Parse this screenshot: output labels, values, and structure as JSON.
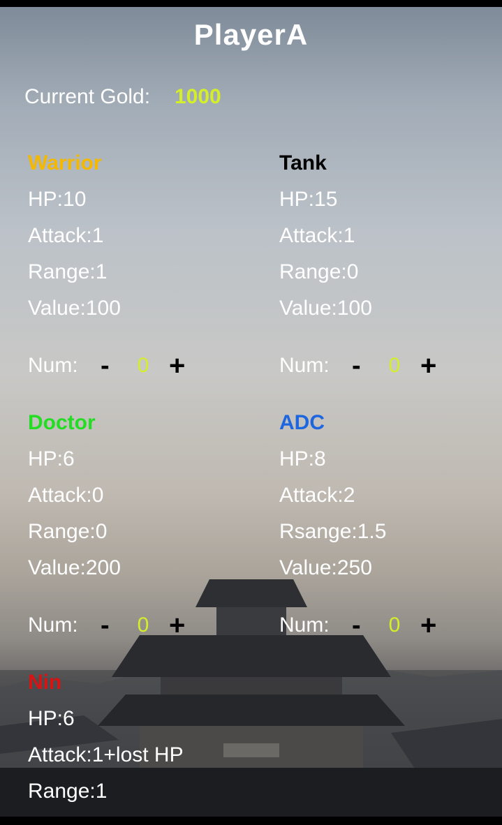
{
  "player": {
    "name": "PlayerA"
  },
  "gold": {
    "label": "Current Gold:",
    "value": "1000"
  },
  "num_label": "Num:",
  "minus_symbol": "-",
  "plus_symbol": "+",
  "units": [
    {
      "name": "Warrior",
      "color": "#f5b800",
      "stats": [
        "HP:10",
        "Attack:1",
        "Range:1",
        "Value:100"
      ],
      "count": "0"
    },
    {
      "name": "Tank",
      "color": "#000000",
      "stats": [
        "HP:15",
        "Attack:1",
        "Range:0",
        "Value:100"
      ],
      "count": "0"
    },
    {
      "name": "Doctor",
      "color": "#22dd22",
      "stats": [
        "HP:6",
        "Attack:0",
        "Range:0",
        "Value:200"
      ],
      "count": "0"
    },
    {
      "name": "ADC",
      "color": "#1e66e0",
      "stats": [
        "HP:8",
        "Attack:2",
        "Rsange:1.5",
        "Value:250"
      ],
      "count": "0"
    },
    {
      "name": "Nin",
      "color": "#d61414",
      "stats": [
        "HP:6",
        "Attack:1+lost HP",
        "Range:1"
      ]
    }
  ]
}
